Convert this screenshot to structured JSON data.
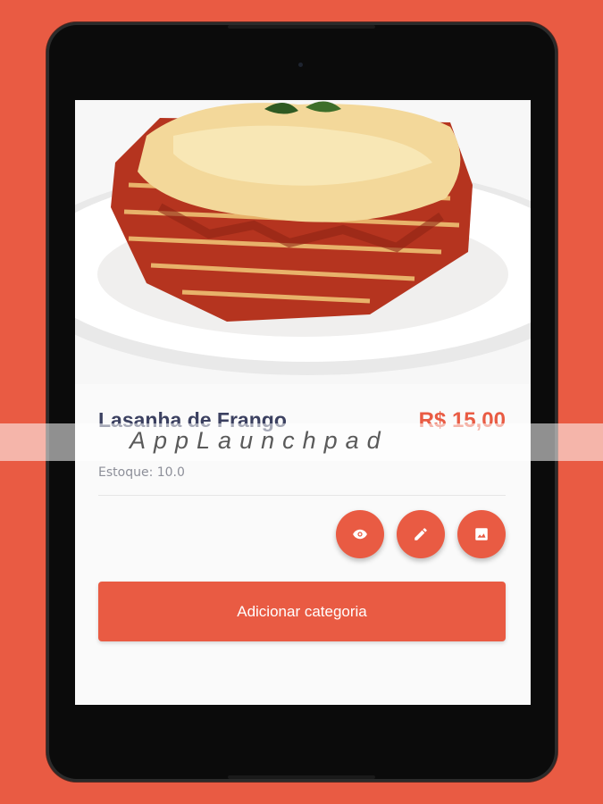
{
  "product": {
    "name": "Lasanha de Frango",
    "price": "R$ 15,00",
    "stock": "Estoque: 10.0",
    "image_icon": "lasagna-photo"
  },
  "actions": {
    "view_icon": "eye-icon",
    "edit_icon": "pencil-icon",
    "image_icon": "image-icon",
    "add_category_label": "Adicionar categoria"
  },
  "watermark": {
    "text": "AppLaunchpad"
  },
  "colors": {
    "accent": "#e95b43",
    "title": "#3b4060",
    "muted": "#8d8f99"
  }
}
